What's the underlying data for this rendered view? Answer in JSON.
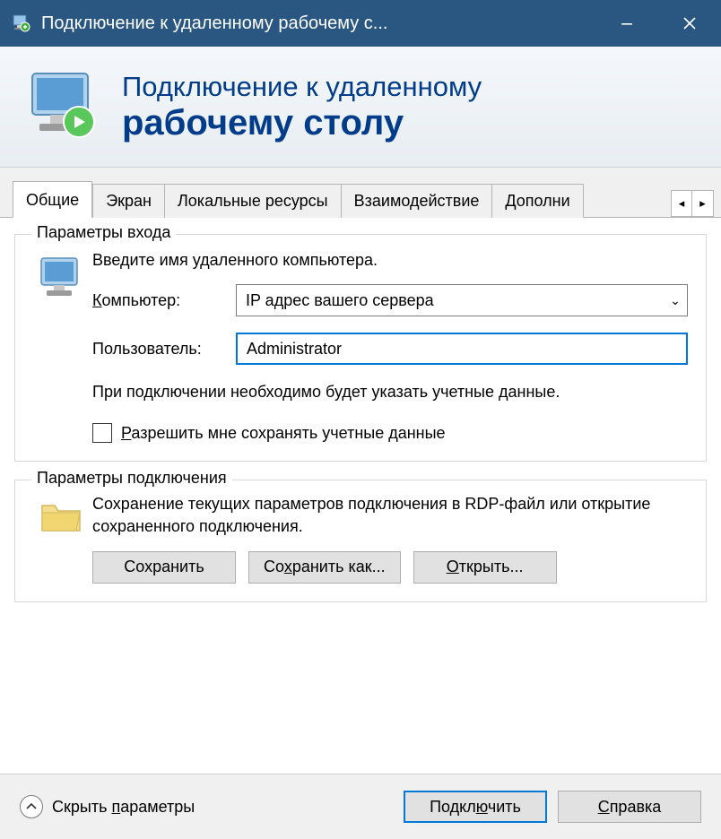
{
  "titlebar": {
    "title": "Подключение к удаленному рабочему с..."
  },
  "banner": {
    "line1": "Подключение к удаленному",
    "line2": "рабочему столу"
  },
  "tabs": [
    {
      "label": "Общие",
      "active": true
    },
    {
      "label": "Экран"
    },
    {
      "label": "Локальные ресурсы"
    },
    {
      "label": "Взаимодействие"
    },
    {
      "label": "Дополни"
    }
  ],
  "login": {
    "legend": "Параметры входа",
    "instruction": "Введите имя удаленного компьютера.",
    "computer_label": "Компьютер:",
    "computer_value": "IP адрес вашего сервера",
    "user_label": "Пользователь:",
    "user_value": "Administrator",
    "note": "При подключении необходимо будет указать учетные данные.",
    "remember_label": "Разрешить мне сохранять учетные данные"
  },
  "connection": {
    "legend": "Параметры подключения",
    "text": "Сохранение текущих параметров подключения в RDP-файл или открытие сохраненного подключения.",
    "save_label": "Сохранить",
    "save_as_label": "Сохранить как...",
    "open_label": "Открыть..."
  },
  "bottom": {
    "hide_label": "Скрыть параметры",
    "connect_label": "Подключить",
    "help_label": "Справка"
  }
}
